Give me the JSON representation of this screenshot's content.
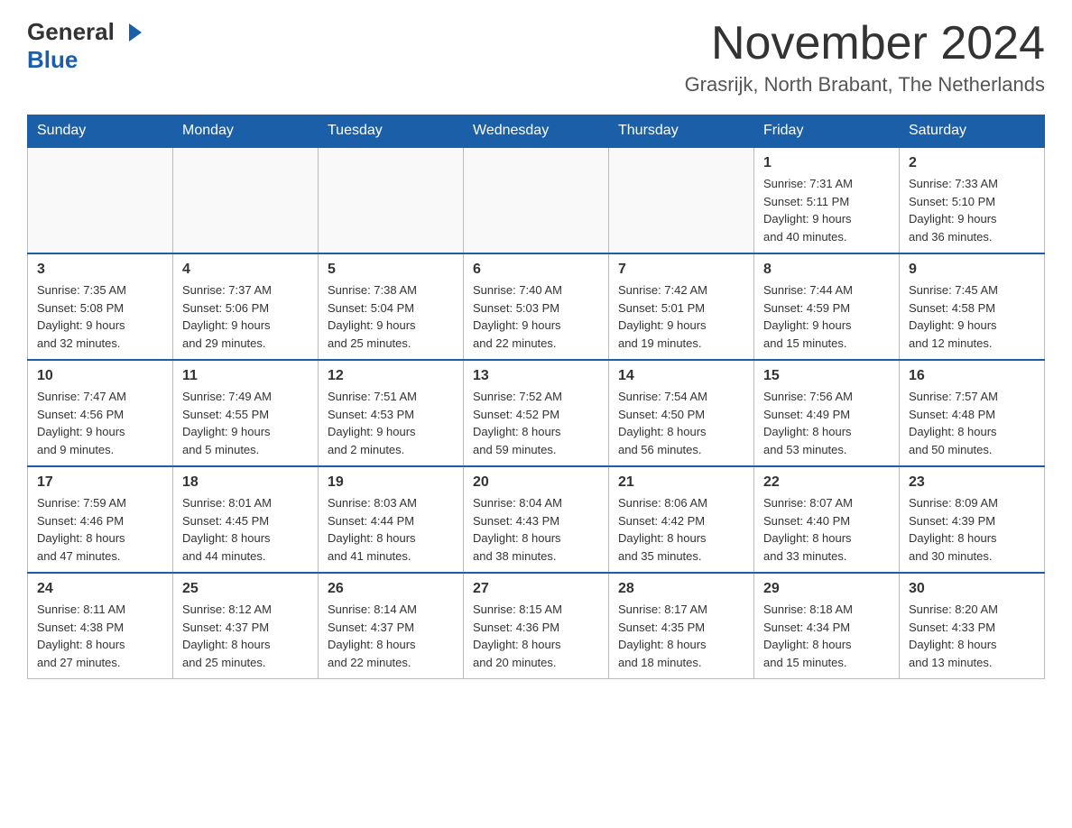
{
  "header": {
    "logo_general": "General",
    "logo_blue": "Blue",
    "month_title": "November 2024",
    "location": "Grasrijk, North Brabant, The Netherlands"
  },
  "calendar": {
    "days_of_week": [
      "Sunday",
      "Monday",
      "Tuesday",
      "Wednesday",
      "Thursday",
      "Friday",
      "Saturday"
    ],
    "weeks": [
      [
        {
          "day": "",
          "info": ""
        },
        {
          "day": "",
          "info": ""
        },
        {
          "day": "",
          "info": ""
        },
        {
          "day": "",
          "info": ""
        },
        {
          "day": "",
          "info": ""
        },
        {
          "day": "1",
          "info": "Sunrise: 7:31 AM\nSunset: 5:11 PM\nDaylight: 9 hours\nand 40 minutes."
        },
        {
          "day": "2",
          "info": "Sunrise: 7:33 AM\nSunset: 5:10 PM\nDaylight: 9 hours\nand 36 minutes."
        }
      ],
      [
        {
          "day": "3",
          "info": "Sunrise: 7:35 AM\nSunset: 5:08 PM\nDaylight: 9 hours\nand 32 minutes."
        },
        {
          "day": "4",
          "info": "Sunrise: 7:37 AM\nSunset: 5:06 PM\nDaylight: 9 hours\nand 29 minutes."
        },
        {
          "day": "5",
          "info": "Sunrise: 7:38 AM\nSunset: 5:04 PM\nDaylight: 9 hours\nand 25 minutes."
        },
        {
          "day": "6",
          "info": "Sunrise: 7:40 AM\nSunset: 5:03 PM\nDaylight: 9 hours\nand 22 minutes."
        },
        {
          "day": "7",
          "info": "Sunrise: 7:42 AM\nSunset: 5:01 PM\nDaylight: 9 hours\nand 19 minutes."
        },
        {
          "day": "8",
          "info": "Sunrise: 7:44 AM\nSunset: 4:59 PM\nDaylight: 9 hours\nand 15 minutes."
        },
        {
          "day": "9",
          "info": "Sunrise: 7:45 AM\nSunset: 4:58 PM\nDaylight: 9 hours\nand 12 minutes."
        }
      ],
      [
        {
          "day": "10",
          "info": "Sunrise: 7:47 AM\nSunset: 4:56 PM\nDaylight: 9 hours\nand 9 minutes."
        },
        {
          "day": "11",
          "info": "Sunrise: 7:49 AM\nSunset: 4:55 PM\nDaylight: 9 hours\nand 5 minutes."
        },
        {
          "day": "12",
          "info": "Sunrise: 7:51 AM\nSunset: 4:53 PM\nDaylight: 9 hours\nand 2 minutes."
        },
        {
          "day": "13",
          "info": "Sunrise: 7:52 AM\nSunset: 4:52 PM\nDaylight: 8 hours\nand 59 minutes."
        },
        {
          "day": "14",
          "info": "Sunrise: 7:54 AM\nSunset: 4:50 PM\nDaylight: 8 hours\nand 56 minutes."
        },
        {
          "day": "15",
          "info": "Sunrise: 7:56 AM\nSunset: 4:49 PM\nDaylight: 8 hours\nand 53 minutes."
        },
        {
          "day": "16",
          "info": "Sunrise: 7:57 AM\nSunset: 4:48 PM\nDaylight: 8 hours\nand 50 minutes."
        }
      ],
      [
        {
          "day": "17",
          "info": "Sunrise: 7:59 AM\nSunset: 4:46 PM\nDaylight: 8 hours\nand 47 minutes."
        },
        {
          "day": "18",
          "info": "Sunrise: 8:01 AM\nSunset: 4:45 PM\nDaylight: 8 hours\nand 44 minutes."
        },
        {
          "day": "19",
          "info": "Sunrise: 8:03 AM\nSunset: 4:44 PM\nDaylight: 8 hours\nand 41 minutes."
        },
        {
          "day": "20",
          "info": "Sunrise: 8:04 AM\nSunset: 4:43 PM\nDaylight: 8 hours\nand 38 minutes."
        },
        {
          "day": "21",
          "info": "Sunrise: 8:06 AM\nSunset: 4:42 PM\nDaylight: 8 hours\nand 35 minutes."
        },
        {
          "day": "22",
          "info": "Sunrise: 8:07 AM\nSunset: 4:40 PM\nDaylight: 8 hours\nand 33 minutes."
        },
        {
          "day": "23",
          "info": "Sunrise: 8:09 AM\nSunset: 4:39 PM\nDaylight: 8 hours\nand 30 minutes."
        }
      ],
      [
        {
          "day": "24",
          "info": "Sunrise: 8:11 AM\nSunset: 4:38 PM\nDaylight: 8 hours\nand 27 minutes."
        },
        {
          "day": "25",
          "info": "Sunrise: 8:12 AM\nSunset: 4:37 PM\nDaylight: 8 hours\nand 25 minutes."
        },
        {
          "day": "26",
          "info": "Sunrise: 8:14 AM\nSunset: 4:37 PM\nDaylight: 8 hours\nand 22 minutes."
        },
        {
          "day": "27",
          "info": "Sunrise: 8:15 AM\nSunset: 4:36 PM\nDaylight: 8 hours\nand 20 minutes."
        },
        {
          "day": "28",
          "info": "Sunrise: 8:17 AM\nSunset: 4:35 PM\nDaylight: 8 hours\nand 18 minutes."
        },
        {
          "day": "29",
          "info": "Sunrise: 8:18 AM\nSunset: 4:34 PM\nDaylight: 8 hours\nand 15 minutes."
        },
        {
          "day": "30",
          "info": "Sunrise: 8:20 AM\nSunset: 4:33 PM\nDaylight: 8 hours\nand 13 minutes."
        }
      ]
    ]
  }
}
